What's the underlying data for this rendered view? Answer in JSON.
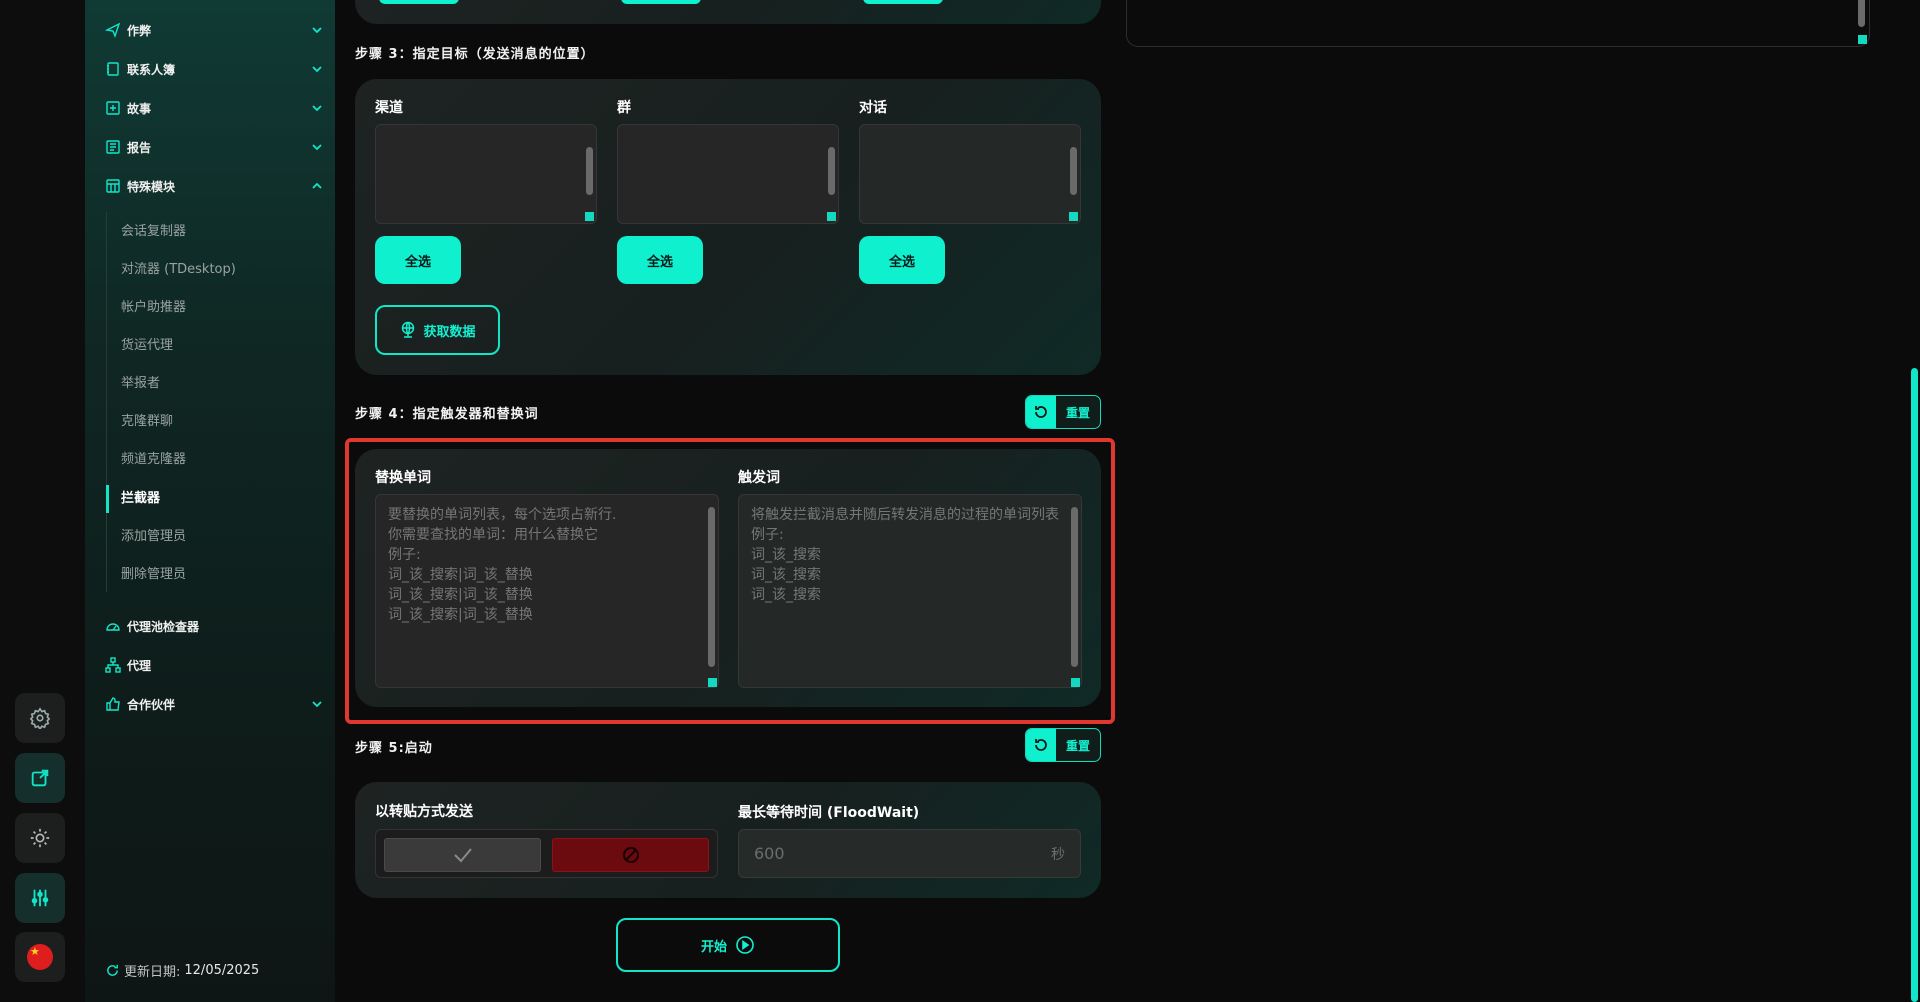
{
  "sidebar": {
    "items": [
      {
        "label": "作弊",
        "icon": "send-icon",
        "expanded": false
      },
      {
        "label": "联系人簿",
        "icon": "contacts-icon",
        "expanded": false
      },
      {
        "label": "故事",
        "icon": "plus-square-icon",
        "expanded": false
      },
      {
        "label": "报告",
        "icon": "report-icon",
        "expanded": false
      },
      {
        "label": "特殊模块",
        "icon": "table-icon",
        "expanded": true
      },
      {
        "label": "代理池检查器",
        "icon": "speedometer-icon"
      },
      {
        "label": "代理",
        "icon": "network-icon"
      },
      {
        "label": "合作伙伴",
        "icon": "thumbs-up-icon",
        "expanded": false
      }
    ],
    "sub_items": [
      "会话复制器",
      "对流器 (TDesktop)",
      "帐户助推器",
      "货运代理",
      "举报者",
      "克隆群聊",
      "频道克隆器",
      "拦截器",
      "添加管理员",
      "删除管理员"
    ],
    "active_sub_item": "拦截器",
    "update_label": "更新日期:",
    "update_date": "12/05/2025"
  },
  "step3": {
    "title": "步骤 3：指定目标（发送消息的位置）",
    "columns": [
      {
        "label": "渠道",
        "select_all": "全选"
      },
      {
        "label": "群",
        "select_all": "全选"
      },
      {
        "label": "对话",
        "select_all": "全选"
      }
    ],
    "fetch_button": "获取数据"
  },
  "step4": {
    "title": "步骤 4：指定触发器和替换词",
    "reset_label": "重置",
    "replace_label": "替换单词",
    "replace_placeholder": "要替换的单词列表，每个选项占新行.\n你需要查找的单词：用什么替换它\n例子:\n词_该_搜索|词_该_替换\n词_该_搜索|词_该_替换\n词_该_搜索|词_该_替换",
    "trigger_label": "触发词",
    "trigger_placeholder": "将触发拦截消息并随后转发消息的过程的单词列表\n例子:\n词_该_搜索\n词_该_搜索\n词_该_搜索"
  },
  "step5": {
    "title": "步骤 5:启动",
    "reset_label": "重置",
    "forward_label": "以转贴方式发送",
    "forward_enabled": false,
    "floodwait_label": "最长等待时间 (FloodWait)",
    "floodwait_placeholder": "600",
    "floodwait_unit": "秒",
    "start_button": "开始"
  },
  "colors": {
    "accent": "#0ff0cf",
    "highlight": "#e0372f",
    "danger": "#6b0a0f"
  }
}
